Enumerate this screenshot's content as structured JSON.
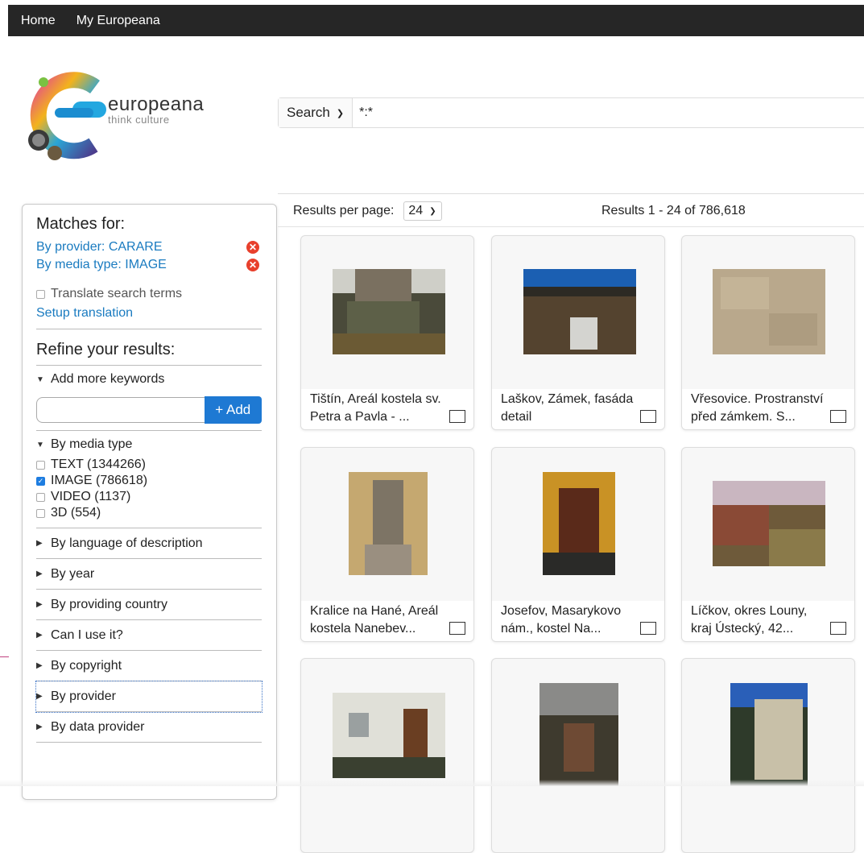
{
  "topnav": {
    "home": "Home",
    "my_europeana": "My Europeana"
  },
  "logo": {
    "brand": "europeana",
    "tagline": "think culture"
  },
  "search": {
    "type_label": "Search",
    "query": "*:*"
  },
  "sidebar": {
    "matches_heading": "Matches for:",
    "filters": [
      {
        "label": "By provider: CARARE"
      },
      {
        "label": "By media type: IMAGE"
      }
    ],
    "translate_label": "Translate search terms",
    "setup_translation": "Setup translation",
    "refine_heading": "Refine your results:",
    "add_keywords_label": "Add more keywords",
    "add_button": "+ Add",
    "media_type_label": "By media type",
    "media_types": [
      {
        "label": "TEXT (1344266)",
        "checked": false
      },
      {
        "label": "IMAGE (786618)",
        "checked": true
      },
      {
        "label": "VIDEO (1137)",
        "checked": false
      },
      {
        "label": "3D (554)",
        "checked": false
      }
    ],
    "facets": [
      "By language of description",
      "By year",
      "By providing country",
      "Can I use it?",
      "By copyright",
      "By provider",
      "By data provider"
    ]
  },
  "results": {
    "per_page_label": "Results per page:",
    "per_page_value": "24",
    "count_text": "Results  1 - 24 of 786,618"
  },
  "cards": [
    {
      "line1": "Tištín, Areál kostela sv.",
      "line2": "Petra a Pavla - ..."
    },
    {
      "line1": "Laškov, Zámek, fasáda",
      "line2": "detail"
    },
    {
      "line1": "Vřesovice. Prostranství",
      "line2": "před zámkem. S..."
    },
    {
      "line1": "Kralice na Hané, Areál",
      "line2": "kostela Nanebev..."
    },
    {
      "line1": "Josefov, Masarykovo",
      "line2": "nám., kostel Na..."
    },
    {
      "line1": "Líčkov, okres Louny,",
      "line2": "kraj Ústecký, 42..."
    },
    {
      "line1": "",
      "line2": ""
    },
    {
      "line1": "",
      "line2": ""
    },
    {
      "line1": "",
      "line2": ""
    }
  ],
  "colors": {
    "link": "#1a7bc0",
    "add_button": "#1e79d3",
    "remove_icon": "#e8402c",
    "topbar": "#262626"
  }
}
